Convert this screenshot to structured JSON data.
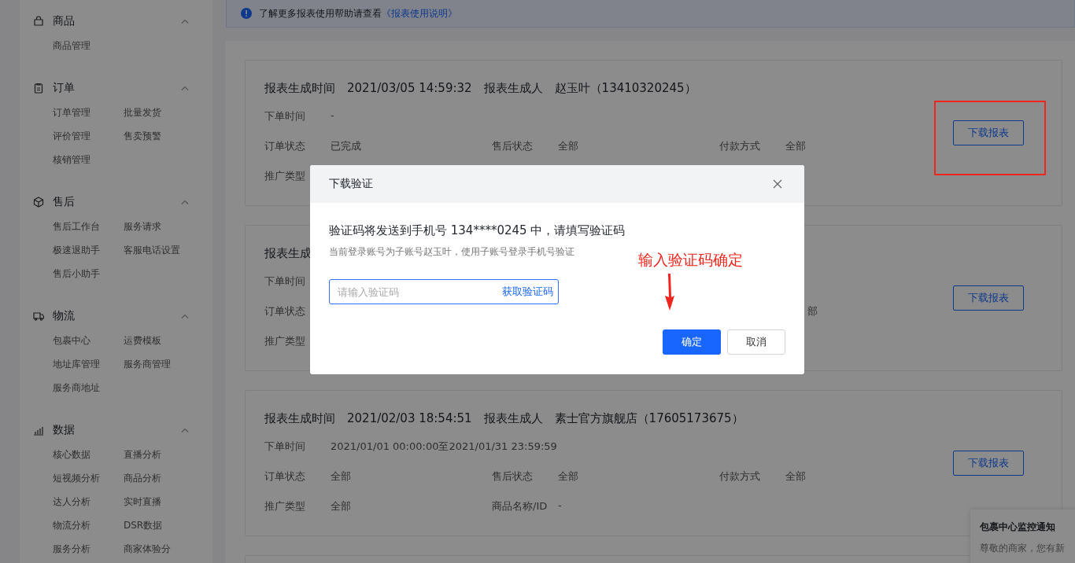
{
  "sidebar": {
    "sections": [
      {
        "title": "商品",
        "expanded": true,
        "items": [
          "商品管理"
        ]
      },
      {
        "title": "订单",
        "expanded": true,
        "items": [
          "订单管理",
          "批量发货",
          "评价管理",
          "售卖预警",
          "核销管理"
        ]
      },
      {
        "title": "售后",
        "expanded": true,
        "items": [
          "售后工作台",
          "服务请求",
          "极速退助手",
          "客服电话设置",
          "售后小助手"
        ]
      },
      {
        "title": "物流",
        "expanded": true,
        "items": [
          "包裹中心",
          "运费模板",
          "地址库管理",
          "服务商管理",
          "服务商地址"
        ]
      },
      {
        "title": "数据",
        "expanded": true,
        "items": [
          "核心数据",
          "直播分析",
          "短视频分析",
          "商品分析",
          "达人分析",
          "实时直播",
          "物流分析",
          "DSR数据",
          "服务分析",
          "商家体验分"
        ]
      }
    ]
  },
  "notice": {
    "text": "了解更多报表使用帮助请查看",
    "link": "《报表使用说明》"
  },
  "reports": [
    {
      "title": [
        "报表生成时间",
        "2021/03/05 14:59:32",
        "报表生成人",
        "赵玉叶（13410320245）"
      ],
      "rows": [
        [
          {
            "label": "下单时间",
            "value": "-"
          }
        ],
        [
          {
            "label": "订单状态",
            "value": "已完成"
          },
          {
            "label": "售后状态",
            "value": "全部"
          },
          {
            "label": "付款方式",
            "value": "全部"
          }
        ],
        [
          {
            "label": "推广类型"
          }
        ]
      ],
      "button": "下载报表"
    },
    {
      "title": [
        "报表生成"
      ],
      "rows": [
        [
          {
            "label": "下单时间"
          }
        ],
        [
          {
            "label": "订单状态"
          },
          {},
          {
            "value": "部"
          }
        ],
        [
          {
            "label": "推广类型"
          }
        ]
      ],
      "button": "下载报表"
    },
    {
      "title": [
        "报表生成时间",
        "2021/02/03 18:54:51",
        "报表生成人",
        "素士官方旗舰店（17605173675）"
      ],
      "rows": [
        [
          {
            "label": "下单时间",
            "value": "2021/01/01 00:00:00至2021/01/31 23:59:59"
          }
        ],
        [
          {
            "label": "订单状态",
            "value": "全部"
          },
          {
            "label": "售后状态",
            "value": "全部"
          },
          {
            "label": "付款方式",
            "value": "全部"
          }
        ],
        [
          {
            "label": "推广类型",
            "value": "全部"
          },
          {
            "label": "商品名称/ID",
            "value": "-"
          }
        ]
      ],
      "button": "下载报表"
    }
  ],
  "modal": {
    "title": "下载验证",
    "message": "验证码将发送到手机号 134****0245 中，请填写验证码",
    "hint": "当前登录账号为子账号赵玉叶，使用子账号登录手机号验证",
    "input": {
      "placeholder": "请输入验证码"
    },
    "get_code": "获取验证码",
    "confirm": "确定",
    "cancel": "取消"
  },
  "annotation": {
    "text": "输入验证码确定"
  },
  "notification": {
    "title": "包裹中心监控通知",
    "body": "尊敬的商家，您有新"
  }
}
